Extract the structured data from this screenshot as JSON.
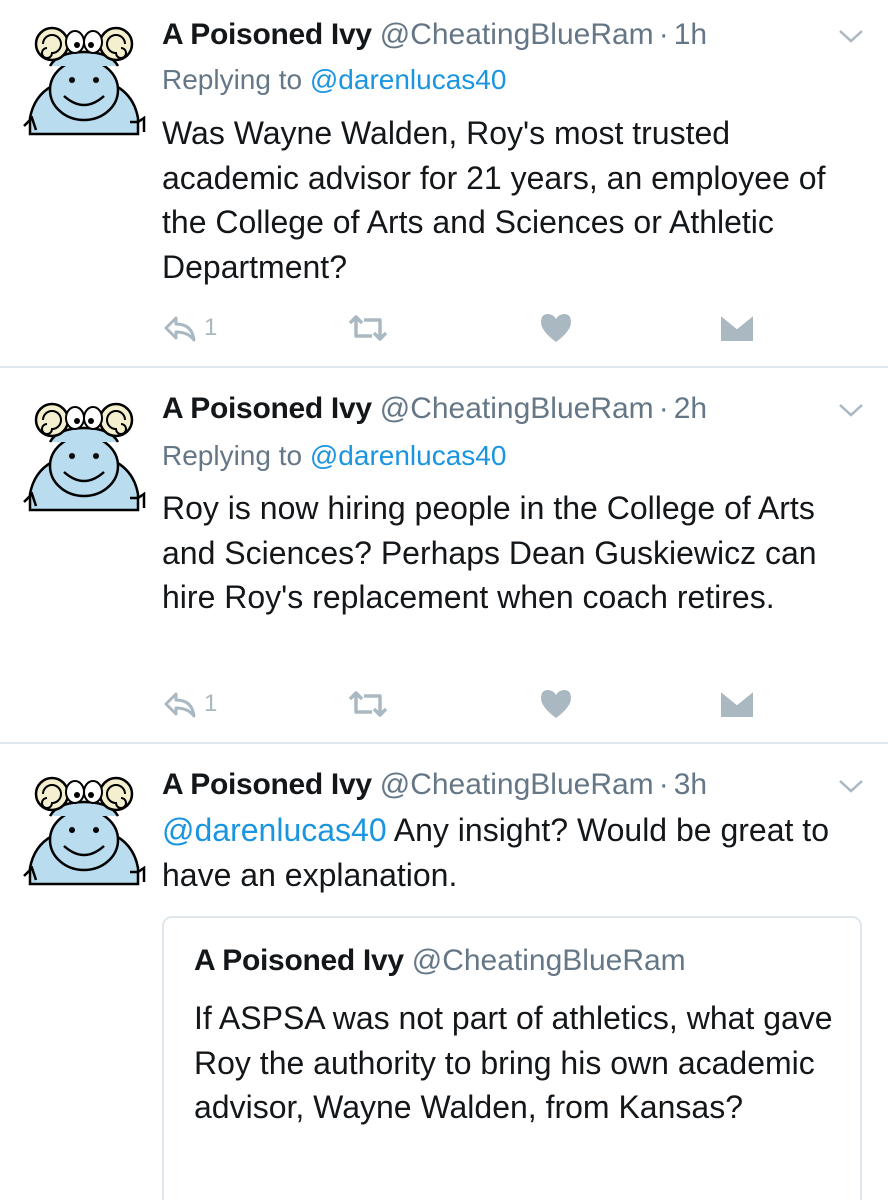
{
  "colors": {
    "link": "#1b95e0",
    "muted": "#657786",
    "icon": "#aab8c2",
    "divider": "#e1e8ed"
  },
  "tweets": [
    {
      "name": "A Poisoned Ivy",
      "handle": "@CheatingBlueRam",
      "separator": "·",
      "time": "1h",
      "reply_prefix": "Replying to",
      "reply_to": "@darenlucas40",
      "text": "Was Wayne Walden, Roy's most trusted academic advisor for 21 years, an employee of the College of Arts and Sciences or Athletic Department?",
      "reply_count": "1",
      "icons": {
        "reply": "reply-icon",
        "retweet": "retweet-icon",
        "like": "heart-icon",
        "dm": "direct-message-icon",
        "menu": "chevron-down-icon"
      }
    },
    {
      "name": "A Poisoned Ivy",
      "handle": "@CheatingBlueRam",
      "separator": "·",
      "time": "2h",
      "reply_prefix": "Replying to",
      "reply_to": "@darenlucas40",
      "text": "Roy is now hiring people in the College of Arts and Sciences? Perhaps Dean Guskiewicz can hire Roy's replacement when coach retires.",
      "reply_count": "1"
    },
    {
      "name": "A Poisoned Ivy",
      "handle": "@CheatingBlueRam",
      "separator": "·",
      "time": "3h",
      "mention": "@darenlucas40",
      "text": " Any insight? Would be great to have an explanation.",
      "quoted": {
        "name": "A Poisoned Ivy",
        "handle": "@CheatingBlueRam",
        "text": "If ASPSA was not part of athletics, what gave Roy the authority to bring his own academic advisor, Wayne Walden, from Kansas?"
      }
    }
  ]
}
